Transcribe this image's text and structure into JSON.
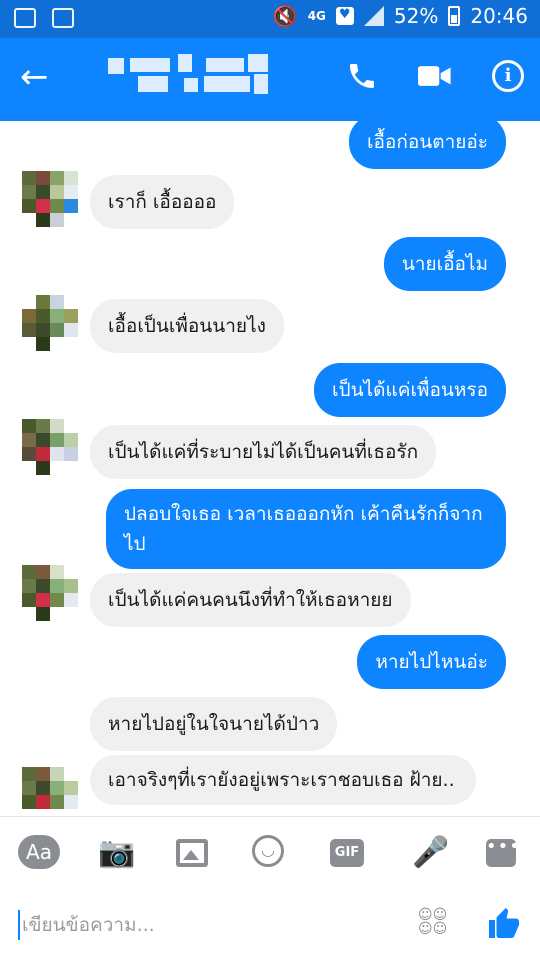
{
  "status_bar": {
    "network": "4G",
    "battery": "52%",
    "time": "20:46"
  },
  "header": {
    "back_icon": "back-arrow-icon",
    "call_icon": "phone-icon",
    "video_icon": "video-camera-icon",
    "info_icon": "info-icon",
    "accent_color": "#0f84ff"
  },
  "messages": [
    {
      "side": "out",
      "text": "เอื้อก่อนตายอ่ะ"
    },
    {
      "side": "in",
      "text": "เราก็ เอื้ออออ"
    },
    {
      "side": "out",
      "text": "นายเอื้อไม"
    },
    {
      "side": "in",
      "text": "เอื้อเป็นเพื่อนนายไง"
    },
    {
      "side": "out",
      "text": "เป็นได้แค่เพื่อนหรอ"
    },
    {
      "side": "in",
      "text": "เป็นได้แค่ที่ระบายไม่ได้เป็นคนที่เธอรัก"
    },
    {
      "side": "out",
      "text": "ปลอบใจเธอ เวลาเธอออกหัก เค้าคืนรักก็จากไป"
    },
    {
      "side": "in",
      "text": "เป็นได้แค่คนคนนึงที่ทำให้เธอหายย"
    },
    {
      "side": "out",
      "text": "หายไปไหนอ่ะ"
    },
    {
      "side": "in",
      "text": "หายไปอยู่ในใจนายได้ป่าว"
    },
    {
      "side": "in",
      "text": "เอาจริงๆที่เรายังอยู่เพราะเราชอบเธอ ฝ้าย.."
    }
  ],
  "composer": {
    "aa_label": "Aa",
    "gif_label": "GIF",
    "placeholder": "เขียนข้อความ..."
  }
}
